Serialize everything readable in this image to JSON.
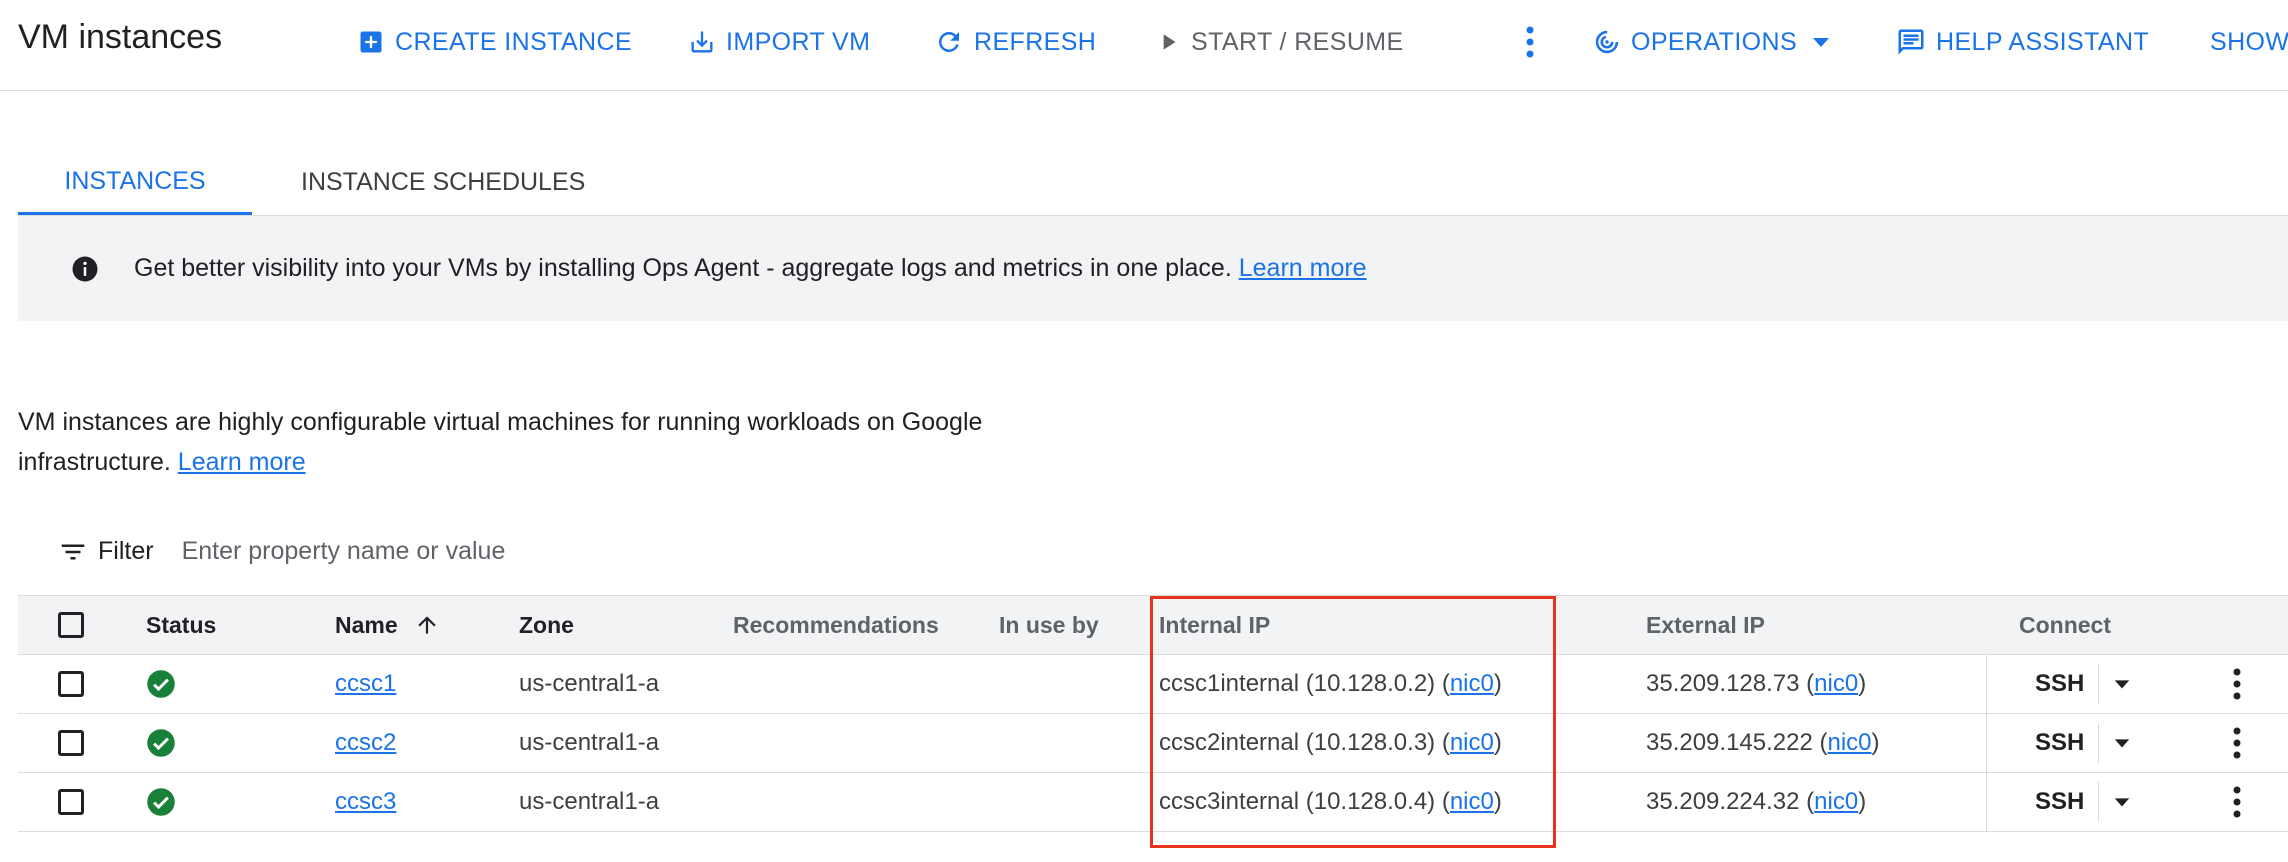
{
  "header": {
    "title": "VM instances",
    "actions": {
      "create_instance": "CREATE INSTANCE",
      "import_vm": "IMPORT VM",
      "refresh": "REFRESH",
      "start_resume": "START / RESUME",
      "operations": "OPERATIONS",
      "help_assistant": "HELP ASSISTANT",
      "show": "SHOW"
    }
  },
  "tabs": [
    {
      "label": "INSTANCES",
      "active": true
    },
    {
      "label": "INSTANCE SCHEDULES",
      "active": false
    }
  ],
  "banner": {
    "text": "Get better visibility into your VMs by installing Ops Agent - aggregate logs and metrics in one place.",
    "link": "Learn more"
  },
  "description": {
    "text": "VM instances are highly configurable virtual machines for running workloads on Google infrastructure.",
    "link": "Learn more"
  },
  "filter": {
    "label": "Filter",
    "placeholder": "Enter property name or value"
  },
  "table": {
    "columns": {
      "status": "Status",
      "name": "Name",
      "zone": "Zone",
      "recommendations": "Recommendations",
      "in_use_by": "In use by",
      "internal_ip": "Internal IP",
      "external_ip": "External IP",
      "connect": "Connect"
    },
    "rows": [
      {
        "name": "ccsc1",
        "zone": "us-central1-a",
        "internal_ip": "ccsc1internal (10.128.0.2)",
        "internal_nic": "nic0",
        "external_ip": "35.209.128.73",
        "external_nic": "nic0",
        "connect": "SSH"
      },
      {
        "name": "ccsc2",
        "zone": "us-central1-a",
        "internal_ip": "ccsc2internal (10.128.0.3)",
        "internal_nic": "nic0",
        "external_ip": "35.209.145.222",
        "external_nic": "nic0",
        "connect": "SSH"
      },
      {
        "name": "ccsc3",
        "zone": "us-central1-a",
        "internal_ip": "ccsc3internal (10.128.0.4)",
        "internal_nic": "nic0",
        "external_ip": "35.209.224.32",
        "external_nic": "nic0",
        "connect": "SSH"
      }
    ]
  },
  "colors": {
    "accent": "#1a73e8",
    "status_ok": "#188038",
    "highlight": "#e8321e"
  },
  "icons": [
    "add-box-icon",
    "import-icon",
    "refresh-icon",
    "play-icon",
    "more-vert-icon",
    "operations-icon",
    "arrow-drop-down-icon",
    "help-assistant-icon",
    "info-icon",
    "filter-icon",
    "sort-arrow-up-icon",
    "check-circle-icon"
  ]
}
